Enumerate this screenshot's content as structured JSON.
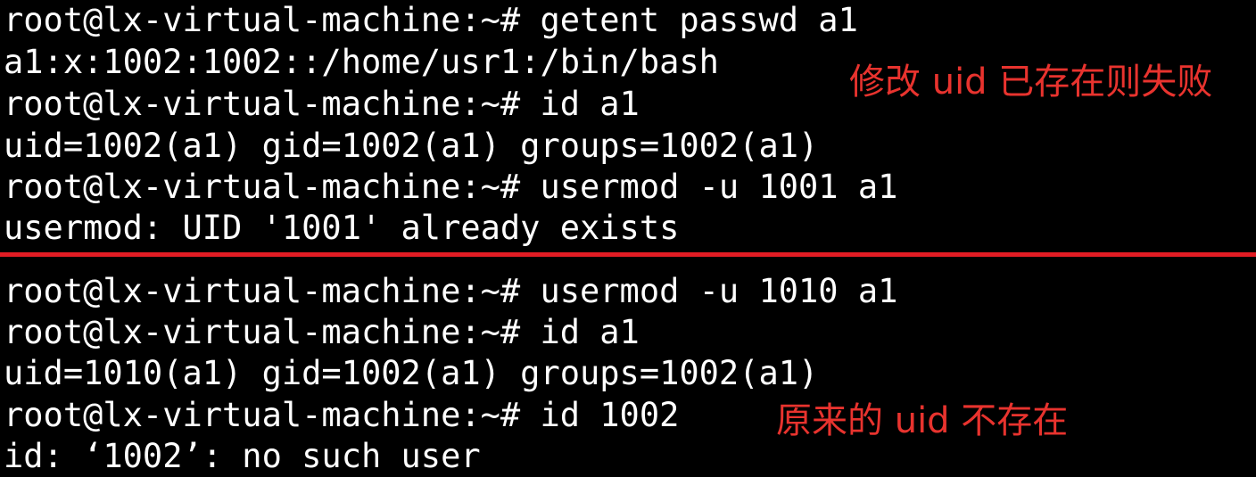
{
  "terminal": {
    "lines": [
      "root@lx-virtual-machine:~# getent passwd a1",
      "a1:x:1002:1002::/home/usr1:/bin/bash",
      "root@lx-virtual-machine:~# id a1",
      "uid=1002(a1) gid=1002(a1) groups=1002(a1)",
      "root@lx-virtual-machine:~# usermod -u 1001 a1",
      "usermod: UID '1001' already exists",
      "root@lx-virtual-machine:~# usermod -u 1010 a1",
      "root@lx-virtual-machine:~# id a1",
      "uid=1010(a1) gid=1002(a1) groups=1002(a1)",
      "root@lx-virtual-machine:~# id 1002",
      "id: ‘1002’: no such user"
    ]
  },
  "annotations": {
    "modify_fail": "修改 uid 已存在则失败",
    "original_missing": "原来的 uid 不存在"
  },
  "colors": {
    "background": "#000000",
    "text": "#ffffff",
    "annotation": "#e8332e",
    "divider": "#e21c24"
  }
}
